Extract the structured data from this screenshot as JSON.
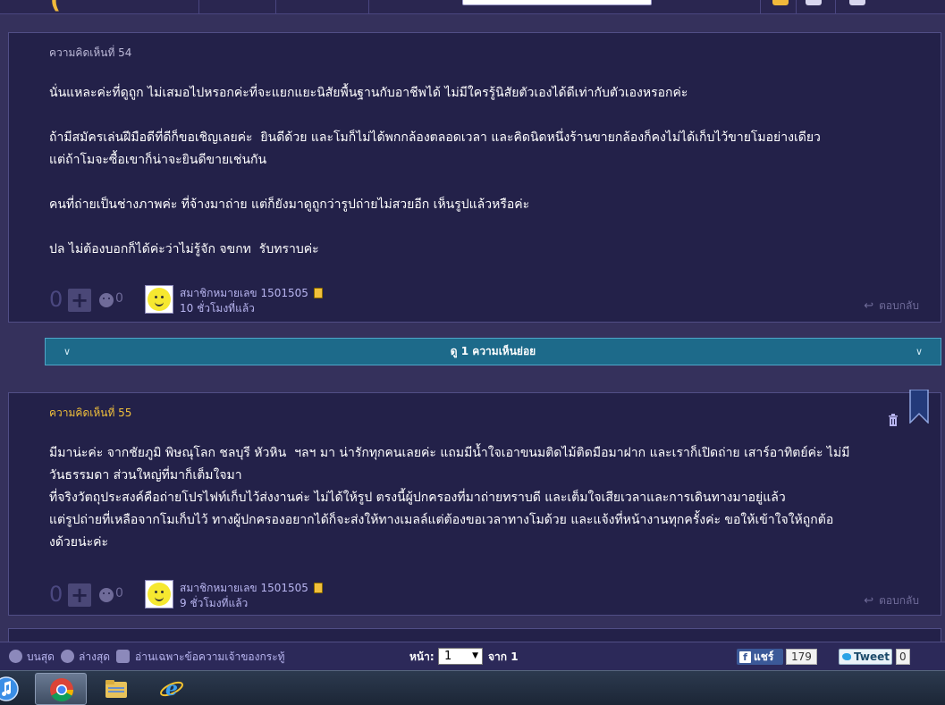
{
  "comments": [
    {
      "label": "ความคิดเห็นที่ 54",
      "paragraphs": [
        "นั่นแหละค่ะที่ดูถูก ไม่เสมอไปหรอกค่ะที่จะแยกแยะนิสัยพื้นฐานกับอาชีพได้ ไม่มีใครรู้นิสัยตัวเองได้ดีเท่ากับตัวเองหรอกค่ะ",
        "ถ้ามีสมัครเล่นฝีมือดีที่ดีก็ขอเชิญเลยค่ะ  ยินดีด้วย และโมก็ไม่ได้พกกล้องตลอดเวลา และคิดนิดหนึ่งร้านขายกล้องก็คงไม่ได้เก็บไว้ขายโมอย่างเดียว\nแต่ถ้าโมจะซื้อเขาก็น่าจะยินดีขายเช่นกัน",
        "คนที่ถ่ายเป็นช่างภาพค่ะ ที่จ้างมาถ่าย แต่ก็ยังมาดูถูกว่ารูปถ่ายไม่สวยอีก เห็นรูปแล้วหรือค่ะ",
        "ปล ไม่ต้องบอกก็ได้ค่ะว่าไม่รู้จัก จขกท  รับทราบค่ะ"
      ],
      "votes": "0",
      "emoji_count": "0",
      "member": "สมาชิกหมายเลข 1501505",
      "time": "10 ชั่วโมงที่แล้ว",
      "reply": "ตอบกลับ"
    },
    {
      "label": "ความคิดเห็นที่ 55",
      "paragraphs": [
        "มีมาน่ะค่ะ จากชัยภูมิ พิษณุโลก ชลบุรี หัวหิน  ฯลฯ มา น่ารักทุกคนเลยค่ะ แถมมีน้ำใจเอาขนมติดไม้ติดมือมาฝาก และเราก็เปิดถ่าย เสาร์อาทิตย์ค่ะ ไม่มี\nวันธรรมดา ส่วนใหญ่ที่มาก็เต็มใจมา\nที่จริงวัตถุประสงค์คือถ่ายโปรไฟท์เก็บไว้ส่งงานค่ะ ไม่ได้ให้รูป ตรงนี้ผู้ปกครองที่มาถ่ายทราบดี และเต็มใจเสียเวลาและการเดินทางมาอยู่แล้ว\nแต่รูปถ่ายที่เหลือจากโมเก็บไว้ ทางผู้ปกครองอยากได้ก็จะส่งให้ทางเมลล์แต่ต้องขอเวลาทางโมด้วย และแจ้งที่หน้างานทุกครั้งค่ะ ขอให้เข้าใจให้ถูกต้อ\nงด้วยน่ะค่ะ"
      ],
      "votes": "0",
      "emoji_count": "0",
      "member": "สมาชิกหมายเลข 1501505",
      "time": "9 ชั่วโมงที่แล้ว",
      "reply": "ตอบกลับ"
    }
  ],
  "expand_bar": {
    "label": "ดู 1 ความเห็นย่อย"
  },
  "toolbar": {
    "top": "บนสุด",
    "bottom": "ล่างสุด",
    "owner_only": "อ่านเฉพาะข้อความเจ้าของกระทู้",
    "page_label": "หน้า:",
    "page_value": "1",
    "of_label": "จาก 1",
    "fb_share": "แชร์",
    "fb_count": "179",
    "tweet": "Tweet",
    "tweet_count": "0"
  },
  "colors": {
    "background": "#35315c",
    "card": "#232149",
    "accent_gold": "#f1c03b",
    "expand_bar": "#1d6a8a",
    "member_link": "#b8b5f0"
  }
}
